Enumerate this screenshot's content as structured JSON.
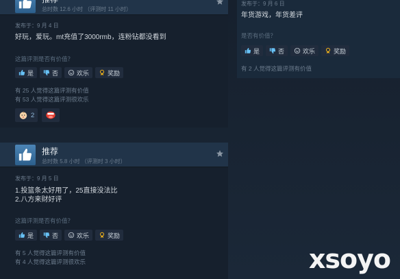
{
  "review1": {
    "recommend": "推荐",
    "hours": "总时数 12.6 小时 （评测时 11 小时）",
    "posted": "发布于：9 月 4 日",
    "text": "好玩，爱玩。mt充值了3000rmb，连粉钻都没看到",
    "helpful_question": "这篇评测是否有价值？",
    "buttons": {
      "yes": "是",
      "no": "否",
      "funny": "欢乐",
      "award": "奖励"
    },
    "helpful_count": "有 25 人觉得这篇评测有价值",
    "funny_count": "有 53 人觉得这篇评测很欢乐",
    "awards": [
      {
        "icon": "baby-face-award-icon",
        "count": "2"
      },
      {
        "icon": "laughing-mouth-award-icon",
        "count": ""
      }
    ]
  },
  "review2": {
    "recommend": "推荐",
    "hours": "总时数 5.8 小时 （评测时 3 小时）",
    "posted": "发布于：9 月 5 日",
    "text_line1": "1.投篮条太好用了，25直接没法比",
    "text_line2": "2.八方来财好评",
    "helpful_question": "这篇评测是否有价值？",
    "buttons": {
      "yes": "是",
      "no": "否",
      "funny": "欢乐",
      "award": "奖励"
    },
    "helpful_count": "有 5 人觉得这篇评测有价值",
    "funny_count": "有 4 人觉得这篇评测很欢乐"
  },
  "review3": {
    "posted": "发布于：9 月 6 日",
    "text": "年货游戏，年货差评",
    "helpful_question": "是否有价值？",
    "buttons": {
      "yes": "是",
      "no": "否",
      "funny": "欢乐",
      "award": "奖励"
    },
    "helpful_count": "有 2 人觉得这篇评测有价值"
  },
  "watermark": "xsoyo"
}
